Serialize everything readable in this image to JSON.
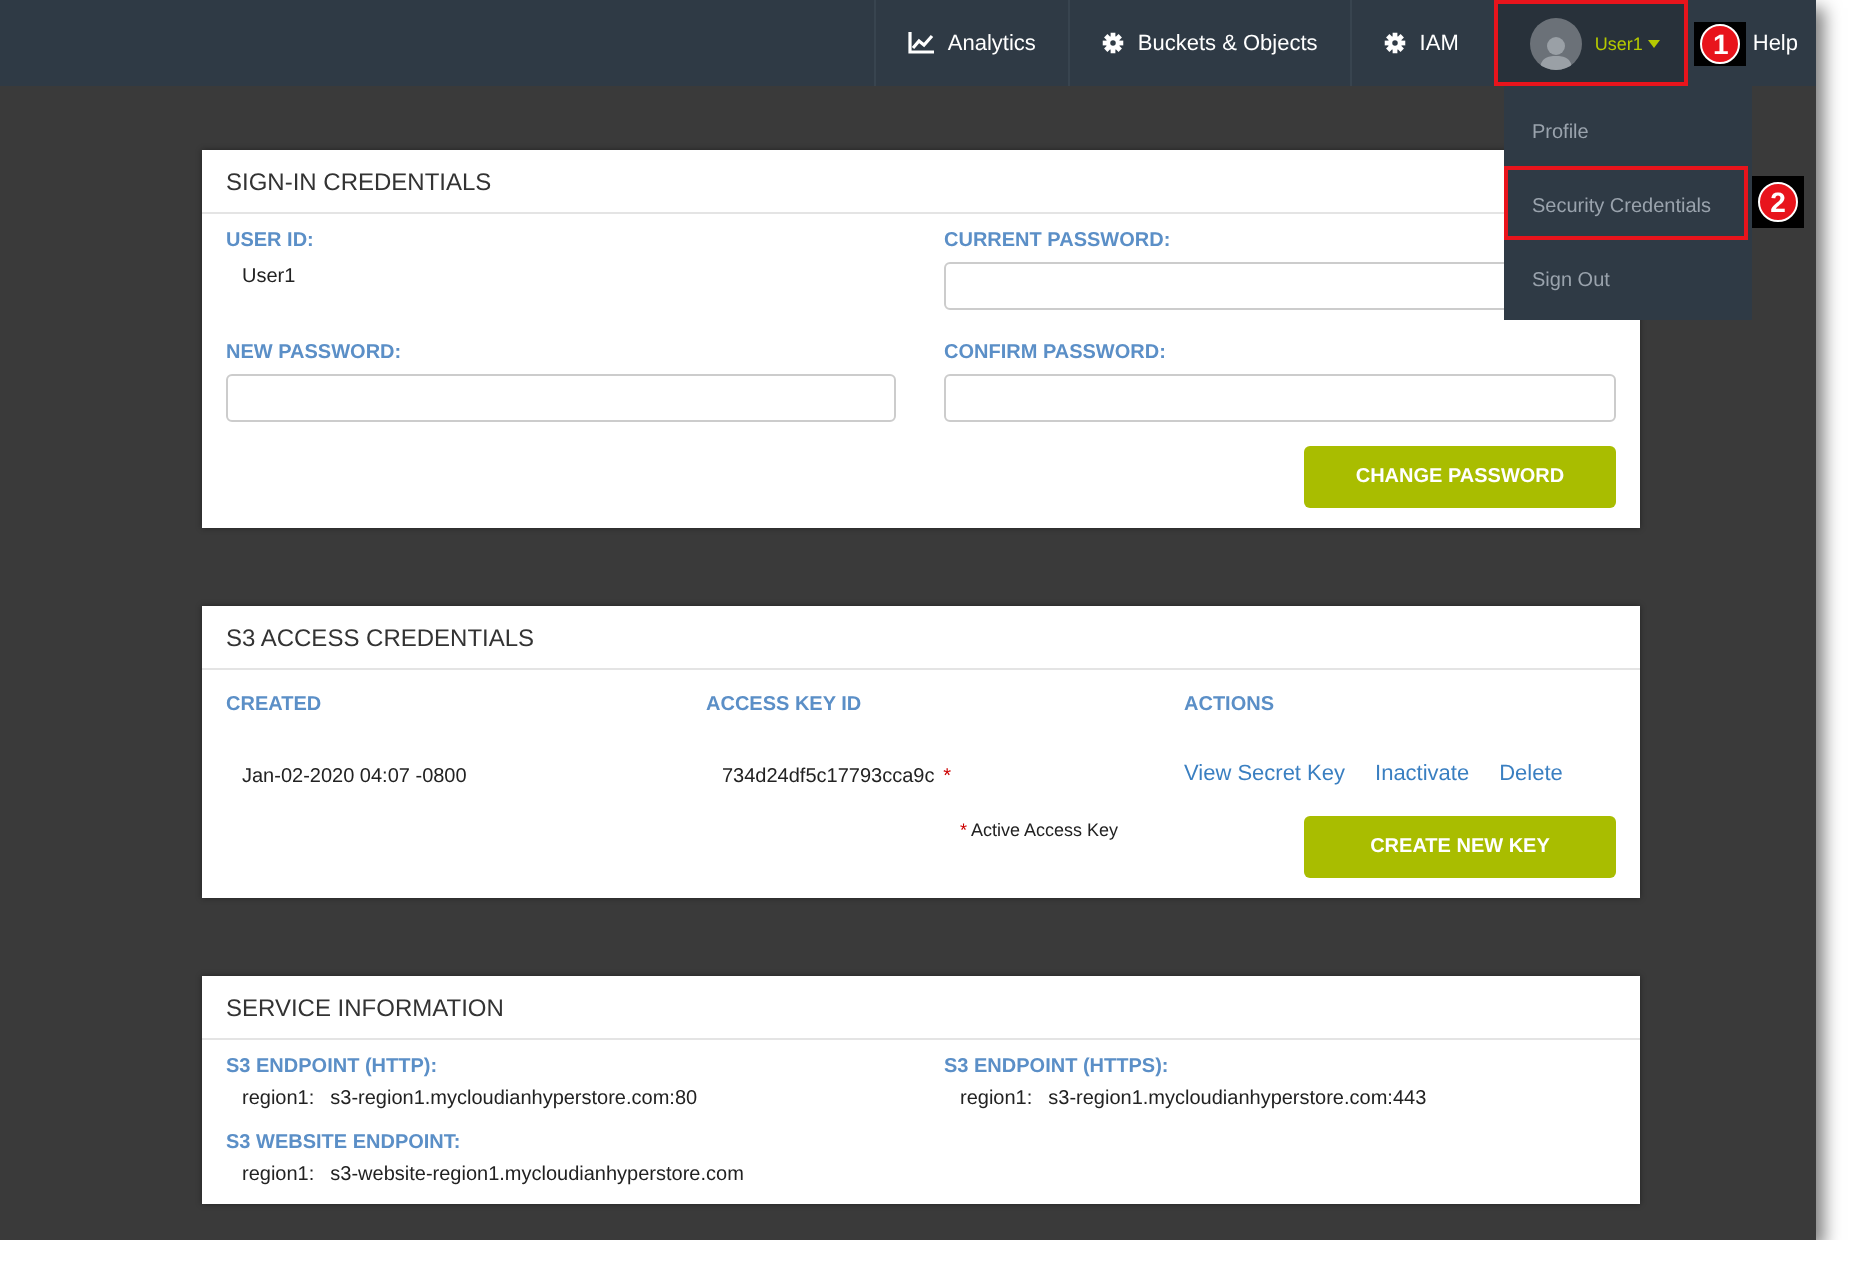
{
  "nav": {
    "items": [
      {
        "label": "Analytics",
        "kind": "chart"
      },
      {
        "label": "Buckets & Objects",
        "kind": "gear"
      },
      {
        "label": "IAM",
        "kind": "gear"
      }
    ],
    "user": {
      "label": "User1",
      "highlighted": true,
      "callout": "1"
    },
    "help": "Help"
  },
  "user_menu": {
    "items": [
      {
        "label": "Profile",
        "highlighted": false
      },
      {
        "label": "Security Credentials",
        "highlighted": true,
        "callout": "2"
      },
      {
        "label": "Sign Out",
        "highlighted": false
      }
    ]
  },
  "sign_in": {
    "title": "SIGN-IN CREDENTIALS",
    "fields": [
      {
        "kind": "text",
        "label": "USER ID:",
        "value": "User1"
      },
      {
        "kind": "input",
        "label": "CURRENT PASSWORD:"
      },
      {
        "kind": "input",
        "label": "NEW PASSWORD:"
      },
      {
        "kind": "input",
        "label": "CONFIRM PASSWORD:"
      }
    ],
    "button": "CHANGE PASSWORD"
  },
  "s3_access": {
    "title": "S3 ACCESS CREDENTIALS",
    "columns": [
      "CREATED",
      "ACCESS KEY ID",
      "ACTIONS"
    ],
    "rows": [
      {
        "created": "Jan-02-2020 04:07 -0800",
        "key_id": "734d24df5c17793cca9c",
        "marker": "*",
        "actions": [
          "View Secret Key",
          "Inactivate",
          "Delete"
        ]
      }
    ],
    "note": {
      "marker": "*",
      "text": "Active Access Key"
    },
    "button": "CREATE NEW KEY"
  },
  "service": {
    "title": "SERVICE INFORMATION",
    "endpoints": [
      {
        "label": "S3 ENDPOINT (HTTP):",
        "region": "region1:",
        "url": "s3-region1.mycloudianhyperstore.com:80"
      },
      {
        "label": "S3 ENDPOINT (HTTPS):",
        "region": "region1:",
        "url": "s3-region1.mycloudianhyperstore.com:443"
      },
      {
        "label": "S3 WEBSITE ENDPOINT:",
        "region": "region1:",
        "url": "s3-website-region1.mycloudianhyperstore.com"
      }
    ]
  }
}
